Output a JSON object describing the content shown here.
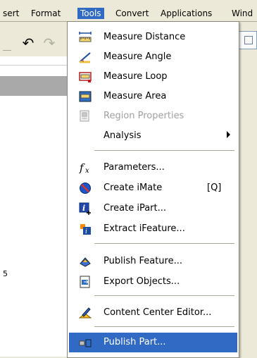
{
  "menubar": {
    "items": [
      {
        "label": "sert"
      },
      {
        "label": "Format"
      },
      {
        "label": "Tools"
      },
      {
        "label": "Convert"
      },
      {
        "label": "Applications"
      },
      {
        "label": "Wind"
      }
    ]
  },
  "panel": {
    "digit": "5"
  },
  "tools_menu": {
    "items": [
      {
        "label": "Measure Distance",
        "icon": "measure-distance-icon"
      },
      {
        "label": "Measure Angle",
        "icon": "measure-angle-icon"
      },
      {
        "label": "Measure Loop",
        "icon": "measure-loop-icon"
      },
      {
        "label": "Measure Area",
        "icon": "measure-area-icon"
      },
      {
        "label": "Region Properties",
        "icon": "region-properties-icon",
        "disabled": true
      },
      {
        "label": "Analysis",
        "submenu": true
      },
      {
        "label": "Parameters...",
        "icon": "fx-icon"
      },
      {
        "label": "Create iMate",
        "icon": "no-entry-icon",
        "shortcut": "[Q]"
      },
      {
        "label": "Create iPart...",
        "icon": "ipart-icon"
      },
      {
        "label": "Extract iFeature...",
        "icon": "ifeature-icon"
      },
      {
        "label": "Publish Feature...",
        "icon": "publish-feature-icon"
      },
      {
        "label": "Export Objects...",
        "icon": "export-objects-icon"
      },
      {
        "label": "Content Center Editor...",
        "icon": "content-center-icon"
      },
      {
        "label": "Publish Part...",
        "icon": "publish-part-icon",
        "selected": true
      }
    ]
  }
}
